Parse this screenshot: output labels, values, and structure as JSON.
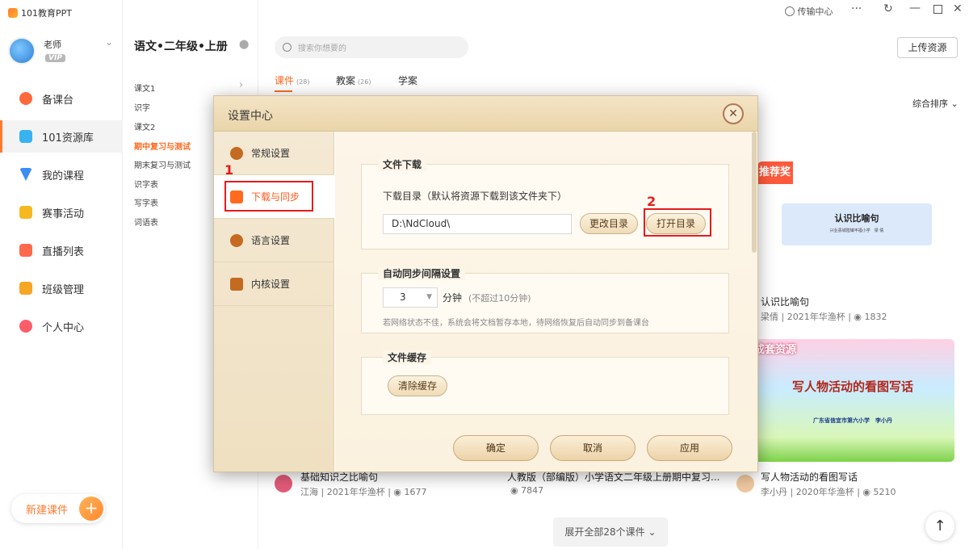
{
  "app": {
    "name": "101教育PPT"
  },
  "titlebar": {
    "transfer_label": "传输中心"
  },
  "user": {
    "name": "老师",
    "badge": "VIP"
  },
  "sidebar": {
    "items": [
      {
        "label": "备课台"
      },
      {
        "label": "101资源库"
      },
      {
        "label": "我的课程"
      },
      {
        "label": "赛事活动"
      },
      {
        "label": "直播列表"
      },
      {
        "label": "班级管理"
      },
      {
        "label": "个人中心"
      }
    ],
    "new_button": "新建课件"
  },
  "catalog": {
    "title": "语文•二年级•上册",
    "lessons": [
      "课文1",
      "识字",
      "课文2",
      "期中复习与测试",
      "期末复习与测试",
      "识字表",
      "写字表",
      "词语表"
    ]
  },
  "search": {
    "placeholder": "搜索你想要的"
  },
  "upload_button": "上传资源",
  "tabs": [
    {
      "label": "课件",
      "count": "(28)"
    },
    {
      "label": "教案",
      "count": "(26)"
    },
    {
      "label": "学案",
      "count": ""
    }
  ],
  "sort": {
    "label": "综合排序"
  },
  "cards": [
    {
      "banner": "推荐奖",
      "thumb_title": "认识比喻句",
      "thumb_sub": "兴业县城隍镇丰福小学　梁 倩",
      "title": "认识比喻句",
      "author": "梁倩",
      "source": "2021年华渔杯",
      "views": "1832"
    },
    {
      "banner": "成套资源",
      "thumb_title": "写人物活动的看图写话",
      "thumb_sub": "广东省信宜市第六小学　李小丹",
      "title": "写人物活动的看图写话",
      "author": "李小丹",
      "source": "2020年华渔杯",
      "views": "5210"
    },
    {
      "title": "基础知识之比喻句",
      "author": "江海",
      "source": "2021年华渔杯",
      "views": "1677"
    },
    {
      "title": "人教版（部编版）小学语文二年级上册期中复习...",
      "views": "7847"
    }
  ],
  "expand_label": "展开全部28个课件",
  "dialog": {
    "title": "设置中心",
    "side": [
      {
        "label": "常规设置"
      },
      {
        "label": "下载与同步"
      },
      {
        "label": "语言设置"
      },
      {
        "label": "内核设置"
      }
    ],
    "download": {
      "section": "文件下载",
      "desc": "下载目录（默认将资源下载到该文件夹下）",
      "path": "D:\\NdCloud\\",
      "change_btn": "更改目录",
      "open_btn": "打开目录"
    },
    "sync": {
      "section": "自动同步间隔设置",
      "value": "3",
      "unit": "分钟",
      "limit": "(不超过10分钟)",
      "hint": "若网络状态不佳，系统会将文档暂存本地，待网络恢复后自动同步到备课台"
    },
    "cache": {
      "section": "文件缓存",
      "clear_btn": "清除缓存"
    },
    "buttons": {
      "ok": "确定",
      "cancel": "取消",
      "apply": "应用"
    }
  },
  "annotations": {
    "one": "1",
    "two": "2"
  },
  "colors": {
    "accent": "#ff6a1f",
    "highlight": "#e51b1b"
  }
}
